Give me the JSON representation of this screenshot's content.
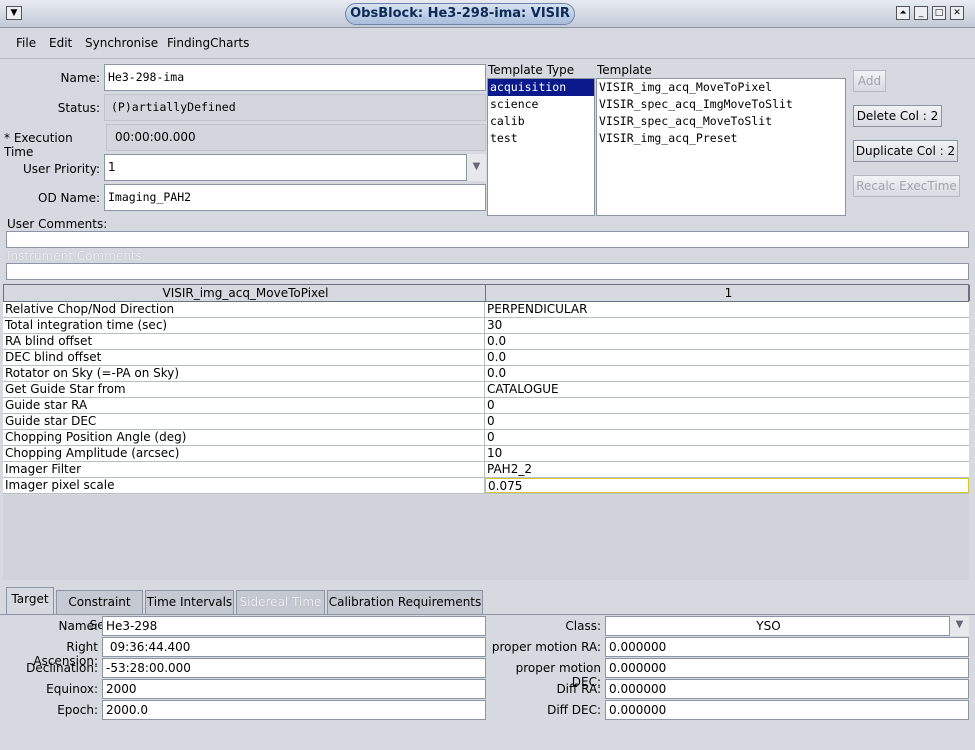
{
  "window": {
    "title": "ObsBlock: He3-298-ima: VISIR"
  },
  "menu": [
    "File",
    "Edit",
    "Synchronise",
    "FindingCharts"
  ],
  "form": {
    "name_label": "Name:",
    "name_value": "He3-298-ima",
    "status_label": "Status:",
    "status_value": "(P)artiallyDefined",
    "exec_label": "* Execution Time",
    "exec_value": "00:00:00.000",
    "priority_label": "User Priority:",
    "priority_value": "1",
    "od_label": "OD Name:",
    "od_value": "Imaging_PAH2",
    "user_comments_label": "User Comments:",
    "instrument_comments_label": "Instrument Comments :"
  },
  "template_type": {
    "header": "Template Type",
    "items": [
      "acquisition",
      "science",
      "calib",
      "test"
    ],
    "selected": "acquisition"
  },
  "template": {
    "header": "Template",
    "items": [
      "VISIR_img_acq_MoveToPixel",
      "VISIR_spec_acq_ImgMoveToSlit",
      "VISIR_spec_acq_MoveToSlit",
      "VISIR_img_acq_Preset"
    ]
  },
  "buttons": {
    "add": "Add",
    "delete_col": "Delete Col : 2",
    "duplicate_col": "Duplicate Col : 2",
    "recalc": "Recalc ExecTime"
  },
  "grid": {
    "header_left": "VISIR_img_acq_MoveToPixel",
    "header_right": "1",
    "rows": [
      {
        "param": "Relative Chop/Nod Direction",
        "value": "PERPENDICULAR"
      },
      {
        "param": "Total integration time (sec)",
        "value": "30"
      },
      {
        "param": "RA blind offset",
        "value": "0.0"
      },
      {
        "param": "DEC blind offset",
        "value": "0.0"
      },
      {
        "param": "Rotator on Sky (=-PA on Sky)",
        "value": "0.0"
      },
      {
        "param": "Get Guide Star from",
        "value": "CATALOGUE"
      },
      {
        "param": "Guide star RA",
        "value": "0"
      },
      {
        "param": "Guide star DEC",
        "value": "0"
      },
      {
        "param": "Chopping Position Angle (deg)",
        "value": "0"
      },
      {
        "param": "Chopping Amplitude (arcsec)",
        "value": "10"
      },
      {
        "param": "Imager Filter",
        "value": "PAH2_2"
      },
      {
        "param": "Imager pixel scale",
        "value": "0.075"
      }
    ]
  },
  "tabs": [
    "Target",
    "Constraint Set",
    "Time Intervals",
    "Sidereal Time",
    "Calibration Requirements"
  ],
  "target": {
    "name_label": "Name:",
    "name_value": "He3-298",
    "ra_label": "Right Ascension:",
    "ra_value": " 09:36:44.400",
    "dec_label": "Declination:",
    "dec_value": "-53:28:00.000",
    "equinox_label": "Equinox:",
    "equinox_value": "2000",
    "epoch_label": "Epoch:",
    "epoch_value": "2000.0",
    "class_label": "Class:",
    "class_value": "YSO",
    "pmra_label": "proper motion RA:",
    "pmra_value": "0.000000",
    "pmdec_label": "proper motion DEC:",
    "pmdec_value": "0.000000",
    "diffra_label": "Diff RA:",
    "diffra_value": "0.000000",
    "diffdec_label": "Diff DEC:",
    "diffdec_value": "0.000000"
  }
}
